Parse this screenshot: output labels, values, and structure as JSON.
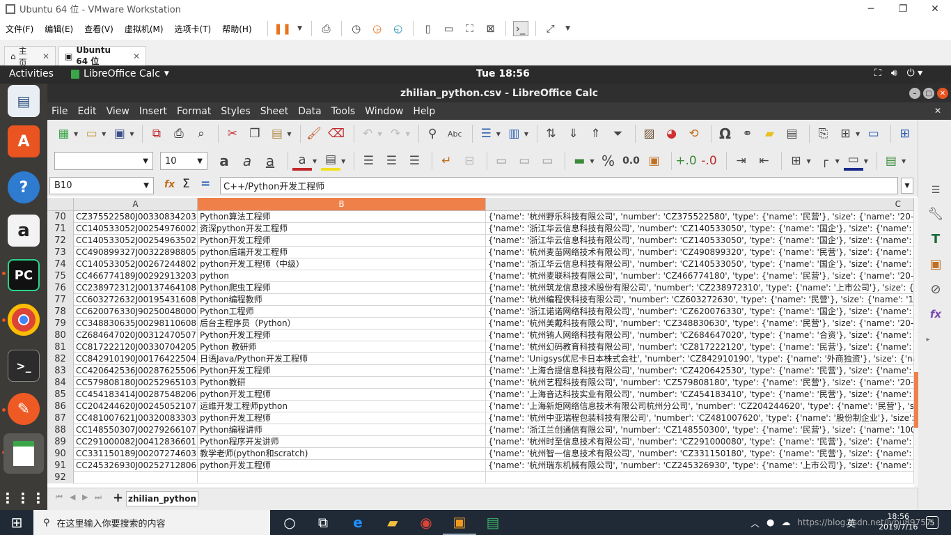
{
  "vmware": {
    "title": "Ubuntu 64 位 - VMware Workstation",
    "menu": [
      "文件(F)",
      "编辑(E)",
      "查看(V)",
      "虚拟机(M)",
      "选项卡(T)",
      "帮助(H)"
    ],
    "tabs": [
      {
        "label": "主页"
      },
      {
        "label": "Ubuntu 64 位"
      }
    ]
  },
  "ubuntu": {
    "activities": "Activities",
    "app_name": "LibreOffice Calc",
    "clock": "Tue 18:56"
  },
  "calc": {
    "window_title": "zhilian_python.csv - LibreOffice Calc",
    "menu": [
      "File",
      "Edit",
      "View",
      "Insert",
      "Format",
      "Styles",
      "Sheet",
      "Data",
      "Tools",
      "Window",
      "Help"
    ],
    "font_name": "",
    "font_size": "10",
    "name_box": "B10",
    "formula": "C++/Python开发工程师",
    "columns": [
      "A",
      "B",
      "C"
    ],
    "rows": [
      {
        "n": "70",
        "a": "CZ375522580J00330834203",
        "b": "Python算法工程师",
        "c": "{'name': '杭州野乐科技有限公司', 'number': 'CZ375522580', 'type': {'name': '民营'}, 'size': {'name': '20-99人'},"
      },
      {
        "n": "71",
        "a": "CC140533052J00254976002",
        "b": "资深python开发工程师",
        "c": "{'name': '浙江华云信息科技有限公司', 'number': 'CZ140533050', 'type': {'name': '国企'}, 'size': {'name': '1000-9"
      },
      {
        "n": "72",
        "a": "CC140533052J00254963502",
        "b": "Python开发工程师",
        "c": "{'name': '浙江华云信息科技有限公司', 'number': 'CZ140533050', 'type': {'name': '国企'}, 'size': {'name': '1000-9"
      },
      {
        "n": "73",
        "a": "CC490899327J00322898805",
        "b": "python后端开发工程师",
        "c": "{'name': '杭州麦苗网络技术有限公司', 'number': 'CZ490899320', 'type': {'name': '民营'}, 'size': {'name': '100-49"
      },
      {
        "n": "74",
        "a": "CC140533052J00267244802",
        "b": "python开发工程师（中级）",
        "c": "{'name': '浙江华云信息科技有限公司', 'number': 'CZ140533050', 'type': {'name': '国企'}, 'size': {'name': '1000-9"
      },
      {
        "n": "75",
        "a": "CC466774189J00292913203",
        "b": "python",
        "c": "{'name': '杭州麦联科技有限公司', 'number': 'CZ466774180', 'type': {'name': '民营'}, 'size': {'name': '20-99人'},"
      },
      {
        "n": "76",
        "a": "CC238972312J00137464108",
        "b": "Python爬虫工程师",
        "c": "{'name': '杭州筑龙信息技术股份有限公司', 'number': 'CZ238972310', 'type': {'name': '上市公司'}, 'size': {'name"
      },
      {
        "n": "77",
        "a": "CC603272632J00195431608",
        "b": "Python编程教师",
        "c": "{'name': '杭州编程侠科技有限公司', 'number': 'CZ603272630', 'type': {'name': '民营'}, 'size': {'name': '100-499"
      },
      {
        "n": "78",
        "a": "CC620076330J90250048000",
        "b": "Python工程师",
        "c": "{'name': '浙江诺诺网络科技有限公司', 'number': 'CZ620076330', 'type': {'name': '国企'}, 'size': {'name': '100-49"
      },
      {
        "n": "79",
        "a": "CC348830635J00298110608",
        "b": "后台主程序员（Python）",
        "c": "{'name': '杭州美戴科技有限公司', 'number': 'CZ348830630', 'type': {'name': '民营'}, 'size': {'name': '20-99人'},"
      },
      {
        "n": "80",
        "a": "CZ684647020J00312470507",
        "b": "Python开发工程师",
        "c": "{'name': '杭州铕人网络科技有限公司', 'number': 'CZ684647020', 'type': {'name': '合资'}, 'size': {'name': '20-99"
      },
      {
        "n": "81",
        "a": "CC817222120J00330704205",
        "b": "Python 教研师",
        "c": "{'name': '杭州幻码教育科技有限公司', 'number': 'CZ817222120', 'type': {'name': '民营'}, 'size': {'name': '20-99"
      },
      {
        "n": "82",
        "a": "CC842910190J00176422504",
        "b": "日语Java/Python开发工程师",
        "c": "{'name': 'Unigsys优尼卡日本株式会社', 'number': 'CZ842910190', 'type': {'name': '外商独资'}, 'size': {'name': '"
      },
      {
        "n": "83",
        "a": "CC420642536J00287625506",
        "b": "Python开发工程师",
        "c": "{'name': '上海合提信息科技有限公司', 'number': 'CZ420642530', 'type': {'name': '民营'}, 'size': {'name': '100-49"
      },
      {
        "n": "84",
        "a": "CC579808180J00252965103",
        "b": "Python教研",
        "c": "{'name': '杭州艺程科技有限公司', 'number': 'CZ579808180', 'type': {'name': '民营'}, 'size': {'name': '20-99人'},"
      },
      {
        "n": "85",
        "a": "CC454183414J00287548206",
        "b": "python开发工程师",
        "c": "{'name': '上海音达科技实业有限公司', 'number': 'CZ454183410', 'type': {'name': '民营'}, 'size': {'name': '100-49"
      },
      {
        "n": "86",
        "a": "CC204244620J00245052107",
        "b": "运维开发工程师python",
        "c": "{'name': '上海新炬网络信息技术有限公司杭州分公司', 'number': 'CZ204244620', 'type': {'name': '民营'}, 'size'"
      },
      {
        "n": "87",
        "a": "CC481007621J00320083303",
        "b": "python开发工程师",
        "c": "{'name': '杭州中亚瑞程包装科技有限公司', 'number': 'CZ481007620', 'type': {'name': '股份制企业'}, 'size': {'na"
      },
      {
        "n": "88",
        "a": "CC148550307J00279266107",
        "b": "Python编程讲师",
        "c": "{'name': '浙江兰创通信有限公司', 'number': 'CZ148550300', 'type': {'name': '民营'}, 'size': {'name': '100-499人'"
      },
      {
        "n": "89",
        "a": "CC291000082J00412836601",
        "b": "Python程序开发讲师",
        "c": "{'name': '杭州时至信息技术有限公司', 'number': 'CZ291000080', 'type': {'name': '民营'}, 'size': {'name': '20人以"
      },
      {
        "n": "90",
        "a": "CC331150189J00207274603",
        "b": "教学老师(python和scratch)",
        "c": "{'name': '杭州智一信息技术有限公司', 'number': 'CZ331150180', 'type': {'name': '民营'}, 'size': {'name': '20-99"
      },
      {
        "n": "91",
        "a": "CC245326930J00252712806",
        "b": "python开发工程师",
        "c": "{'name': '杭州瑞东机械有限公司', 'number': 'CZ245326930', 'type': {'name': '上市公司'}, 'size': {'name': '1000-9"
      },
      {
        "n": "92",
        "a": "",
        "b": "",
        "c": ""
      }
    ],
    "sheet_tab": "zhilian_python"
  },
  "taskbar": {
    "search_placeholder": "在这里输入你要搜索的内容",
    "time": "18:56",
    "date": "2019/7/16",
    "tray_text": "英",
    "watermark": "https://blog.csdn.net/lybu89757"
  }
}
